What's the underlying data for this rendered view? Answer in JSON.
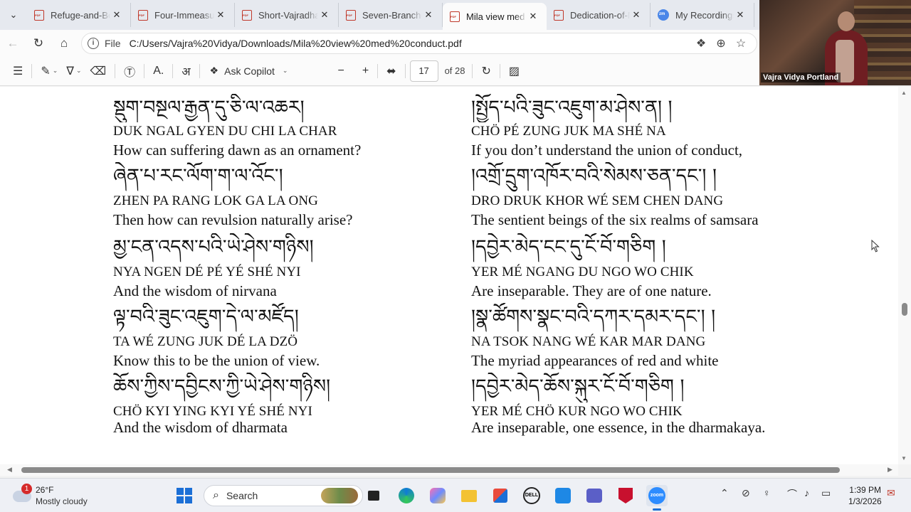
{
  "tabs": [
    {
      "title": "Refuge-and-Bodhicitta",
      "active": false
    },
    {
      "title": "Four-Immeasurables",
      "active": false
    },
    {
      "title": "Short-Vajradhara",
      "active": false
    },
    {
      "title": "Seven-Branch-Prayer",
      "active": false
    },
    {
      "title": "Mila view med conduct",
      "active": true
    },
    {
      "title": "Dedication-of-Merit",
      "active": false
    },
    {
      "title": "My Recordings",
      "active": false
    }
  ],
  "address": {
    "scheme_label": "File",
    "url": "C:/Users/Vajra%20Vidya/Downloads/Mila%20view%20med%20conduct.pdf"
  },
  "pdf_toolbar": {
    "copilot_label": "Ask Copilot",
    "page_number": "17",
    "page_total": "of 28"
  },
  "video": {
    "participant_name": "Vajra Vidya Portland"
  },
  "document": {
    "left": [
      {
        "tibetan": "སྡུག་བསྔལ་རྒྱན་དུ་ཅི་ལ་འཆར།",
        "translit": "DUK NGAL GYEN DU CHI LA CHAR",
        "translation": "How can suffering dawn as an ornament?"
      },
      {
        "tibetan": "ཞེན་པ་རང་ལོག་ག་ལ་འོང་།",
        "translit": "ZHEN PA RANG LOK GA LA ONG",
        "translation": "Then how can revulsion naturally arise?"
      },
      {
        "tibetan": "མྱ་ངན་འདས་པའི་ཡེ་ཤེས་གཉིས།",
        "translit": "NYA NGEN DÉ PÉ YÉ SHÉ NYI",
        "translation": "And the wisdom of nirvana"
      },
      {
        "tibetan": "ལྟ་བའི་ཟུང་འཇུག་དེ་ལ་མཛོད།",
        "translit": "TA WÉ ZUNG JUK DÉ LA DZÖ",
        "translation": "Know this to be the union of view."
      },
      {
        "tibetan": "ཆོས་ཀྱིས་དབྱིངས་ཀྱི་ཡེ་ཤེས་གཉིས།",
        "translit": "CHÖ KYI YING KYI YÉ SHÉ NYI",
        "translation": "And the wisdom of dharmata"
      }
    ],
    "right": [
      {
        "tibetan": "།སྤྱོད་པའི་ཟུང་འཇུག་མ་ཤེས་ན། །",
        "translit": "CHÖ PÉ ZUNG JUK MA SHÉ NA",
        "translation": "If you don’t understand the union of conduct,"
      },
      {
        "tibetan": "།འགྲོ་དྲུག་འཁོར་བའི་སེམས་ཅན་དང་། །",
        "translit": "DRO DRUK KHOR WÉ SEM CHEN DANG",
        "translation": "The sentient beings of the six realms of samsara"
      },
      {
        "tibetan": "།དབྱེར་མེད་ངང་དུ་ངོ་བོ་གཅིག །",
        "translit": "YER MÉ NGANG DU NGO WO CHIK",
        "translation": "Are inseparable. They are of one nature."
      },
      {
        "tibetan": "།སྣ་ཚོགས་སྣང་བའི་དཀར་དམར་དང་། །",
        "translit": "NA TSOK NANG WÉ KAR MAR DANG",
        "translation": "The myriad appearances of red and white"
      },
      {
        "tibetan": "།དབྱེར་མེད་ཆོས་སྐུར་ངོ་བོ་གཅིག །",
        "translit": "YER MÉ CHÖ KUR NGO WO CHIK",
        "translation": "Are inseparable, one essence, in the dharmakaya."
      }
    ]
  },
  "taskbar": {
    "weather_temp": "26°F",
    "weather_condition": "Mostly cloudy",
    "notification_count": "1",
    "search_label": "Search",
    "time": "1:39 PM",
    "date": "1/3/2026"
  }
}
